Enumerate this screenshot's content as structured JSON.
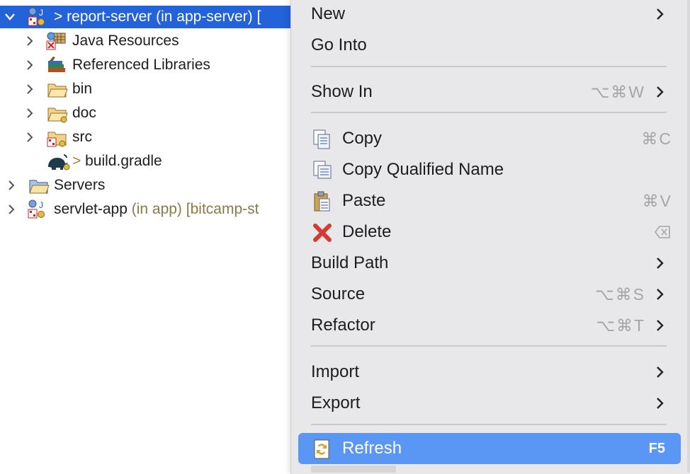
{
  "tree": {
    "items": [
      {
        "label": "> report-server",
        "decoration": " (in app-server)",
        "suffix": " [",
        "selected": true
      },
      {
        "label": "Java Resources"
      },
      {
        "label": "Referenced Libraries"
      },
      {
        "label": "bin"
      },
      {
        "label": "doc"
      },
      {
        "label": "src"
      },
      {
        "prefix": "> ",
        "label": "build.gradle"
      },
      {
        "label": "Servers"
      },
      {
        "label": "servlet-app",
        "decoration": " (in app) [bitcamp-st"
      }
    ]
  },
  "menu": {
    "new": {
      "label": "New"
    },
    "go_into": {
      "label": "Go Into"
    },
    "show_in": {
      "label": "Show In",
      "shortcut": "⌥⌘W"
    },
    "copy": {
      "label": "Copy",
      "shortcut": "⌘C"
    },
    "copy_qualified": {
      "label": "Copy Qualified Name"
    },
    "paste": {
      "label": "Paste",
      "shortcut": "⌘V"
    },
    "delete": {
      "label": "Delete"
    },
    "build_path": {
      "label": "Build Path"
    },
    "source": {
      "label": "Source",
      "shortcut": "⌥⌘S"
    },
    "refactor": {
      "label": "Refactor",
      "shortcut": "⌥⌘T"
    },
    "import": {
      "label": "Import"
    },
    "export": {
      "label": "Export"
    },
    "refresh": {
      "label": "Refresh",
      "shortcut": "F5",
      "highlighted": true
    }
  },
  "colors": {
    "selection": "#2462d9",
    "menu_background": "#e8e7ea",
    "menu_highlight": "#5a97f5",
    "decoration_text": "#8a7a48"
  }
}
